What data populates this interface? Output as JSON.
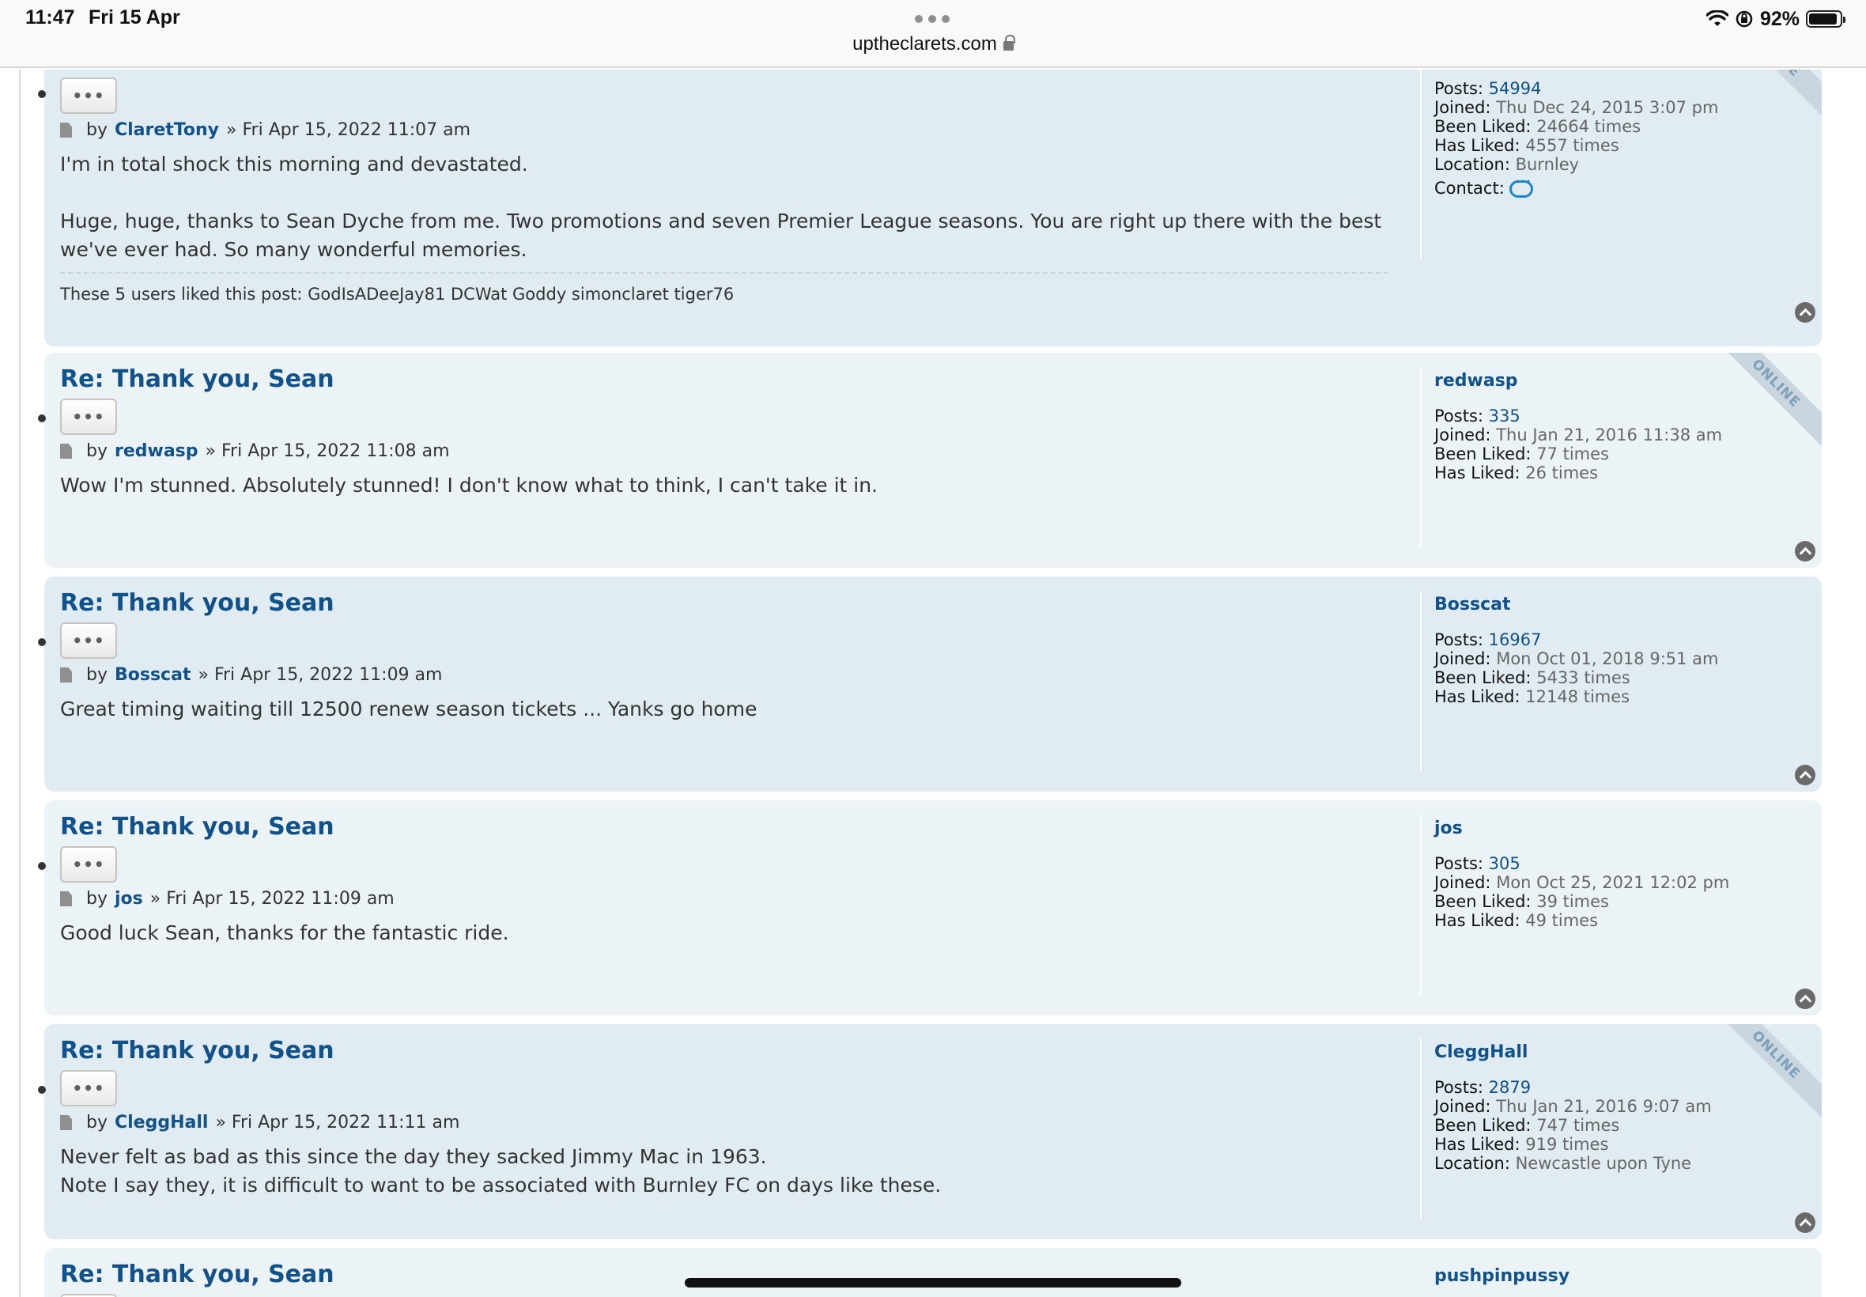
{
  "status_bar": {
    "time": "11:47",
    "date": "Fri 15 Apr",
    "battery": "92%",
    "battery_level": 0.92,
    "url": "uptheclarets.com"
  },
  "labels": {
    "by": "by",
    "sep": "»",
    "posts": "Posts:",
    "joined": "Joined:",
    "been_liked": "Been Liked:",
    "has_liked": "Has Liked:",
    "location": "Location:",
    "contact": "Contact:",
    "online": "ONLINE",
    "more": "•••"
  },
  "posts": [
    {
      "title": "",
      "author": "ClaretTony",
      "date": "Fri Apr 15, 2022 11:07 am",
      "content": [
        "I'm in total shock this morning and devastated.",
        "Huge, huge, thanks to Sean Dyche from me. Two promotions and seven Premier League seasons. You are right up there with the best we've ever had. So many wonderful memories."
      ],
      "likes_text": "These 5 users liked this post: GodIsADeeJay81 DCWat Goddy simonclaret tiger76",
      "online": true,
      "profile": {
        "posts": "54994",
        "joined": "Thu Dec 24, 2015 3:07 pm",
        "been_liked": "24664 times",
        "has_liked": "4557 times",
        "location": "Burnley",
        "contact": true
      }
    },
    {
      "title": "Re: Thank you, Sean",
      "author": "redwasp",
      "date": "Fri Apr 15, 2022 11:08 am",
      "content": [
        "Wow I'm stunned. Absolutely stunned! I don't know what to think, I can't take it in."
      ],
      "online": true,
      "profile": {
        "posts": "335",
        "joined": "Thu Jan 21, 2016 11:38 am",
        "been_liked": "77 times",
        "has_liked": "26 times"
      }
    },
    {
      "title": "Re: Thank you, Sean",
      "author": "Bosscat",
      "date": "Fri Apr 15, 2022 11:09 am",
      "content": [
        "Great timing waiting till 12500 renew season tickets ... Yanks go home"
      ],
      "online": false,
      "profile": {
        "posts": "16967",
        "joined": "Mon Oct 01, 2018 9:51 am",
        "been_liked": "5433 times",
        "has_liked": "12148 times"
      }
    },
    {
      "title": "Re: Thank you, Sean",
      "author": "jos",
      "date": "Fri Apr 15, 2022 11:09 am",
      "content": [
        "Good luck Sean, thanks for the fantastic ride."
      ],
      "online": false,
      "profile": {
        "posts": "305",
        "joined": "Mon Oct 25, 2021 12:02 pm",
        "been_liked": "39 times",
        "has_liked": "49 times"
      }
    },
    {
      "title": "Re: Thank you, Sean",
      "author": "CleggHall",
      "date": "Fri Apr 15, 2022 11:11 am",
      "content": [
        "Never felt as bad as this since the day they sacked Jimmy Mac in 1963.<br>Note I say they, it is difficult to want to be associated with Burnley FC on days like these."
      ],
      "online": true,
      "profile": {
        "posts": "2879",
        "joined": "Thu Jan 21, 2016 9:07 am",
        "been_liked": "747 times",
        "has_liked": "919 times",
        "location": "Newcastle upon Tyne"
      }
    },
    {
      "title": "Re: Thank you, Sean",
      "author": "pushpinpussy",
      "online": false,
      "profile": {}
    }
  ]
}
